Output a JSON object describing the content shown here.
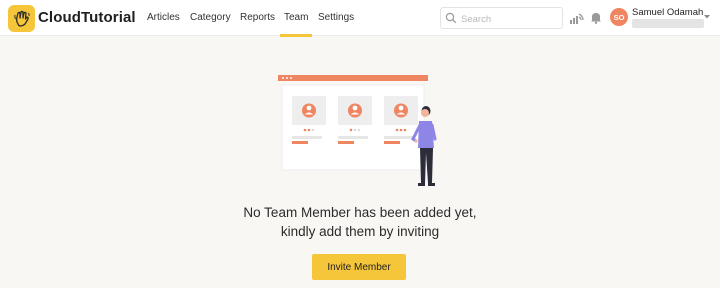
{
  "app": {
    "name": "CloudTutorial",
    "brand_color": "#f6c63a",
    "accent_color": "#f08562"
  },
  "nav": {
    "items": [
      {
        "label": "Articles"
      },
      {
        "label": "Category"
      },
      {
        "label": "Reports"
      },
      {
        "label": "Team",
        "active": true
      },
      {
        "label": "Settings"
      }
    ]
  },
  "search": {
    "placeholder": "Search",
    "icon": "search-icon"
  },
  "toolbar": {
    "broadcast_icon": "broadcast-icon",
    "notification_icon": "bell-icon"
  },
  "user": {
    "initials": "SO",
    "name": "Samuel Odamah",
    "menu_icon": "chevron-down-icon"
  },
  "empty_state": {
    "line1": "No Team Member has been added yet,",
    "line2": "kindly add them by inviting",
    "button_label": "Invite Member"
  }
}
